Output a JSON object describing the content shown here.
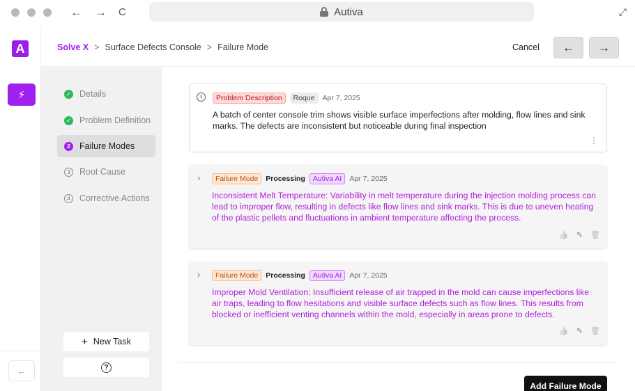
{
  "browser": {
    "url_label": "Autiva",
    "back_glyph": "←",
    "forward_glyph": "→",
    "reload_glyph": "C",
    "expand_glyph": "⤢"
  },
  "app": {
    "logo_letter": "A",
    "brand_color": "#a020f0",
    "rail_action_glyph": "⚡",
    "rail_back_glyph": "←"
  },
  "header": {
    "breadcrumb": [
      "Solve X",
      "Surface Defects Console",
      "Failure Mode"
    ],
    "separator": ">",
    "cancel_label": "Cancel",
    "prev_glyph": "←",
    "next_glyph": "→"
  },
  "steps": [
    {
      "label": "Details",
      "state": "done",
      "marker": "✓"
    },
    {
      "label": "Problem Definition",
      "state": "done",
      "marker": "✓"
    },
    {
      "label": "Failure Modes",
      "state": "active",
      "marker": "2"
    },
    {
      "label": "Root Cause",
      "state": "todo",
      "marker": "3"
    },
    {
      "label": "Corrective Actions",
      "state": "todo",
      "marker": "4"
    }
  ],
  "sidebar": {
    "new_task_label": "New Task",
    "new_task_glyph": "+",
    "help_glyph": "?"
  },
  "problem": {
    "info_glyph": "!",
    "tag": "Problem Description",
    "author": "Roque",
    "date": "Apr 7, 2025",
    "text": "A batch of center console trim shows visible surface imperfections after molding, flow lines and sink marks. The defects are inconsistent but noticeable during final inspection",
    "menu_glyph": "⋮"
  },
  "failure_modes": [
    {
      "tag": "Failure Mode",
      "status": "Processing",
      "source": "Autiva AI",
      "date": "Apr 7, 2025",
      "text": "Inconsistent Melt Temperature: Variability in melt temperature during the injection molding process can lead to improper flow, resulting in defects like flow lines and sink marks. This is due to uneven heating of the plastic pellets and fluctuations in ambient temperature affecting the process."
    },
    {
      "tag": "Failure Mode",
      "status": "Processing",
      "source": "Autiva AI",
      "date": "Apr 7, 2025",
      "text": "Improper Mold Ventilation: Insufficient release of air trapped in the mold can cause imperfections like air traps, leading to flow hesitations and visible surface defects such as flow lines. This results from blocked or inefficient venting channels within the mold, especially in areas prone to defects."
    }
  ],
  "card_icons": {
    "expand": "›",
    "like": "👍",
    "edit": "✎",
    "delete": "🗑"
  },
  "footer": {
    "add_label": "Add Failure Mode"
  }
}
